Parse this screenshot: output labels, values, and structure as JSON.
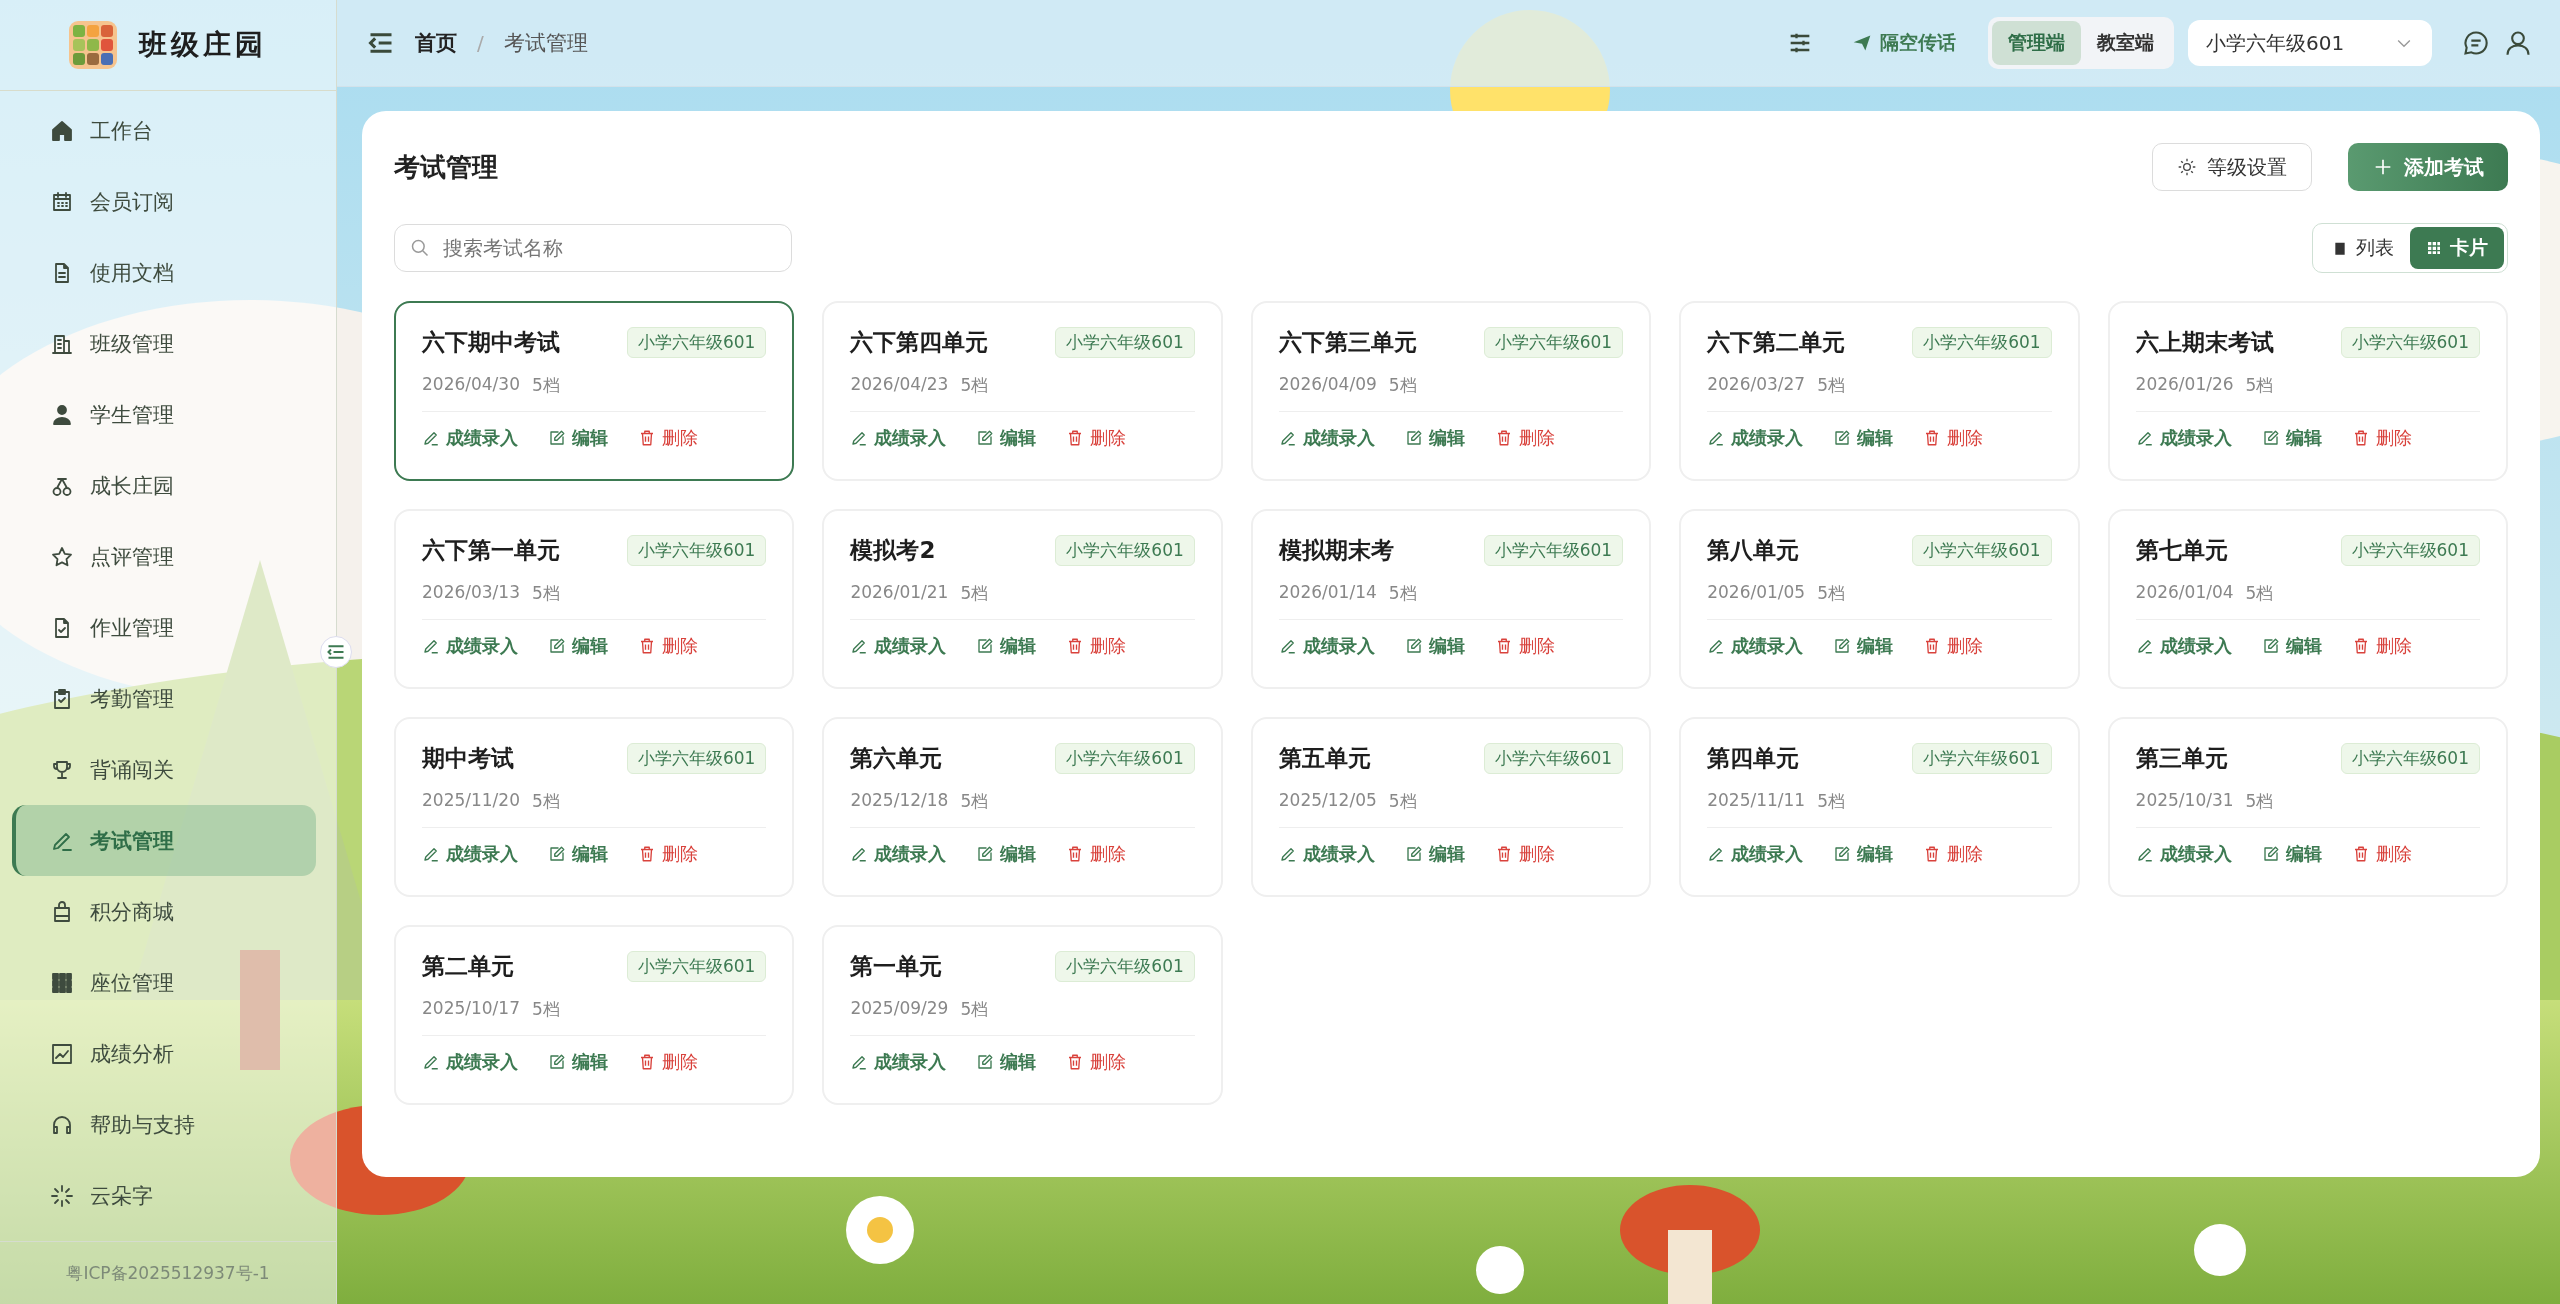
{
  "app": {
    "name": "班级庄园"
  },
  "sidebar": {
    "items": [
      {
        "label": "工作台",
        "selected": false
      },
      {
        "label": "会员订阅",
        "selected": false
      },
      {
        "label": "使用文档",
        "selected": false
      },
      {
        "label": "班级管理",
        "selected": false
      },
      {
        "label": "学生管理",
        "selected": false
      },
      {
        "label": "成长庄园",
        "selected": false
      },
      {
        "label": "点评管理",
        "selected": false
      },
      {
        "label": "作业管理",
        "selected": false
      },
      {
        "label": "考勤管理",
        "selected": false
      },
      {
        "label": "背诵闯关",
        "selected": false
      },
      {
        "label": "考试管理",
        "selected": true
      },
      {
        "label": "积分商城",
        "selected": false
      },
      {
        "label": "座位管理",
        "selected": false
      },
      {
        "label": "成绩分析",
        "selected": false
      },
      {
        "label": "帮助与支持",
        "selected": false
      },
      {
        "label": "云朵字",
        "selected": false
      }
    ],
    "footer": "粤ICP备2025512937号-1"
  },
  "header": {
    "breadcrumb": [
      "首页",
      "考试管理"
    ],
    "breadcrumb_separator": "/",
    "broadcast": "隔空传话",
    "modes": [
      {
        "label": "管理端",
        "selected": true
      },
      {
        "label": "教室端",
        "selected": false
      }
    ],
    "class_select": {
      "value": "小学六年级601"
    }
  },
  "page": {
    "title": "考试管理",
    "grade_button": "等级设置",
    "add_button": "添加考试",
    "search": {
      "placeholder": "搜索考试名称"
    },
    "views": [
      {
        "label": "列表",
        "selected": false
      },
      {
        "label": "卡片",
        "selected": true
      }
    ],
    "exams": [
      {
        "name": "六下期中考试",
        "class": "小学六年级601",
        "date": "2026/04/30",
        "levels": "5档",
        "selected": true,
        "actions": [
          {
            "kind": "score",
            "label": "成绩录入"
          },
          {
            "kind": "edit",
            "label": "编辑"
          },
          {
            "kind": "delete",
            "label": "删除"
          }
        ]
      },
      {
        "name": "六下第四单元",
        "class": "小学六年级601",
        "date": "2026/04/23",
        "levels": "5档",
        "selected": false,
        "actions": [
          {
            "kind": "score",
            "label": "成绩录入"
          },
          {
            "kind": "edit",
            "label": "编辑"
          },
          {
            "kind": "delete",
            "label": "删除"
          }
        ]
      },
      {
        "name": "六下第三单元",
        "class": "小学六年级601",
        "date": "2026/04/09",
        "levels": "5档",
        "selected": false,
        "actions": [
          {
            "kind": "score",
            "label": "成绩录入"
          },
          {
            "kind": "edit",
            "label": "编辑"
          },
          {
            "kind": "delete",
            "label": "删除"
          }
        ]
      },
      {
        "name": "六下第二单元",
        "class": "小学六年级601",
        "date": "2026/03/27",
        "levels": "5档",
        "selected": false,
        "actions": [
          {
            "kind": "score",
            "label": "成绩录入"
          },
          {
            "kind": "edit",
            "label": "编辑"
          },
          {
            "kind": "delete",
            "label": "删除"
          }
        ]
      },
      {
        "name": "六上期末考试",
        "class": "小学六年级601",
        "date": "2026/01/26",
        "levels": "5档",
        "selected": false,
        "actions": [
          {
            "kind": "score",
            "label": "成绩录入"
          },
          {
            "kind": "edit",
            "label": "编辑"
          },
          {
            "kind": "delete",
            "label": "删除"
          }
        ]
      },
      {
        "name": "六下第一单元",
        "class": "小学六年级601",
        "date": "2026/03/13",
        "levels": "5档",
        "selected": false,
        "actions": [
          {
            "kind": "score",
            "label": "成绩录入"
          },
          {
            "kind": "edit",
            "label": "编辑"
          },
          {
            "kind": "delete",
            "label": "删除"
          }
        ]
      },
      {
        "name": "模拟考2",
        "class": "小学六年级601",
        "date": "2026/01/21",
        "levels": "5档",
        "selected": false,
        "actions": [
          {
            "kind": "score",
            "label": "成绩录入"
          },
          {
            "kind": "edit",
            "label": "编辑"
          },
          {
            "kind": "delete",
            "label": "删除"
          }
        ]
      },
      {
        "name": "模拟期末考",
        "class": "小学六年级601",
        "date": "2026/01/14",
        "levels": "5档",
        "selected": false,
        "actions": [
          {
            "kind": "score",
            "label": "成绩录入"
          },
          {
            "kind": "edit",
            "label": "编辑"
          },
          {
            "kind": "delete",
            "label": "删除"
          }
        ]
      },
      {
        "name": "第八单元",
        "class": "小学六年级601",
        "date": "2026/01/05",
        "levels": "5档",
        "selected": false,
        "actions": [
          {
            "kind": "score",
            "label": "成绩录入"
          },
          {
            "kind": "edit",
            "label": "编辑"
          },
          {
            "kind": "delete",
            "label": "删除"
          }
        ]
      },
      {
        "name": "第七单元",
        "class": "小学六年级601",
        "date": "2026/01/04",
        "levels": "5档",
        "selected": false,
        "actions": [
          {
            "kind": "score",
            "label": "成绩录入"
          },
          {
            "kind": "edit",
            "label": "编辑"
          },
          {
            "kind": "delete",
            "label": "删除"
          }
        ]
      },
      {
        "name": "期中考试",
        "class": "小学六年级601",
        "date": "2025/11/20",
        "levels": "5档",
        "selected": false,
        "actions": [
          {
            "kind": "score",
            "label": "成绩录入"
          },
          {
            "kind": "edit",
            "label": "编辑"
          },
          {
            "kind": "delete",
            "label": "删除"
          }
        ]
      },
      {
        "name": "第六单元",
        "class": "小学六年级601",
        "date": "2025/12/18",
        "levels": "5档",
        "selected": false,
        "actions": [
          {
            "kind": "score",
            "label": "成绩录入"
          },
          {
            "kind": "edit",
            "label": "编辑"
          },
          {
            "kind": "delete",
            "label": "删除"
          }
        ]
      },
      {
        "name": "第五单元",
        "class": "小学六年级601",
        "date": "2025/12/05",
        "levels": "5档",
        "selected": false,
        "actions": [
          {
            "kind": "score",
            "label": "成绩录入"
          },
          {
            "kind": "edit",
            "label": "编辑"
          },
          {
            "kind": "delete",
            "label": "删除"
          }
        ]
      },
      {
        "name": "第四单元",
        "class": "小学六年级601",
        "date": "2025/11/11",
        "levels": "5档",
        "selected": false,
        "actions": [
          {
            "kind": "score",
            "label": "成绩录入"
          },
          {
            "kind": "edit",
            "label": "编辑"
          },
          {
            "kind": "delete",
            "label": "删除"
          }
        ]
      },
      {
        "name": "第三单元",
        "class": "小学六年级601",
        "date": "2025/10/31",
        "levels": "5档",
        "selected": false,
        "actions": [
          {
            "kind": "score",
            "label": "成绩录入"
          },
          {
            "kind": "edit",
            "label": "编辑"
          },
          {
            "kind": "delete",
            "label": "删除"
          }
        ]
      },
      {
        "name": "第二单元",
        "class": "小学六年级601",
        "date": "2025/10/17",
        "levels": "5档",
        "selected": false,
        "actions": [
          {
            "kind": "score",
            "label": "成绩录入"
          },
          {
            "kind": "edit",
            "label": "编辑"
          },
          {
            "kind": "delete",
            "label": "删除"
          }
        ]
      },
      {
        "name": "第一单元",
        "class": "小学六年级601",
        "date": "2025/09/29",
        "levels": "5档",
        "selected": false,
        "actions": [
          {
            "kind": "score",
            "label": "成绩录入"
          },
          {
            "kind": "edit",
            "label": "编辑"
          },
          {
            "kind": "delete",
            "label": "删除"
          }
        ]
      }
    ]
  }
}
